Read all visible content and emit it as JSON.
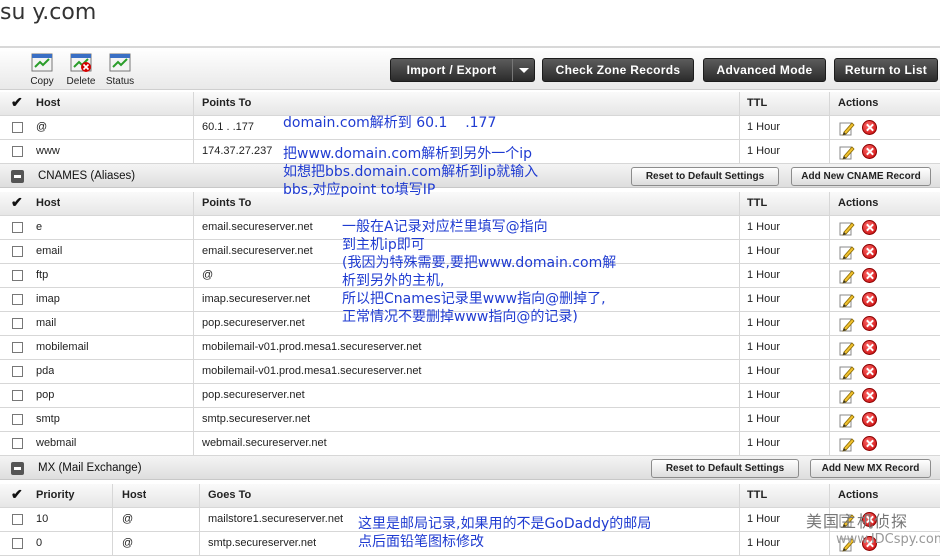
{
  "site": {
    "title": "su   y.com"
  },
  "toolbar": {
    "copy_label": "Copy",
    "delete_label": "Delete",
    "status_label": "Status",
    "import_export_label": "Import / Export",
    "check_zone_label": "Check Zone Records",
    "advanced_mode_label": "Advanced Mode",
    "return_label": "Return to List"
  },
  "a_records": {
    "headers": {
      "host": "Host",
      "points_to": "Points To",
      "ttl": "TTL",
      "actions": "Actions"
    },
    "rows": [
      {
        "host": "@",
        "points_to": "60.1  .  .177",
        "ttl": "1 Hour"
      },
      {
        "host": "www",
        "points_to": "174.37.27.237",
        "ttl": "1 Hour"
      }
    ]
  },
  "cnames": {
    "title": "CNAMES (Aliases)",
    "reset_label": "Reset to Default Settings",
    "add_label": "Add New CNAME Record",
    "headers": {
      "host": "Host",
      "points_to": "Points To",
      "ttl": "TTL",
      "actions": "Actions"
    },
    "rows": [
      {
        "host": "e",
        "points_to": "email.secureserver.net",
        "ttl": "1 Hour"
      },
      {
        "host": "email",
        "points_to": "email.secureserver.net",
        "ttl": "1 Hour"
      },
      {
        "host": "ftp",
        "points_to": "@",
        "ttl": "1 Hour"
      },
      {
        "host": "imap",
        "points_to": "imap.secureserver.net",
        "ttl": "1 Hour"
      },
      {
        "host": "mail",
        "points_to": "pop.secureserver.net",
        "ttl": "1 Hour"
      },
      {
        "host": "mobilemail",
        "points_to": "mobilemail-v01.prod.mesa1.secureserver.net",
        "ttl": "1 Hour"
      },
      {
        "host": "pda",
        "points_to": "mobilemail-v01.prod.mesa1.secureserver.net",
        "ttl": "1 Hour"
      },
      {
        "host": "pop",
        "points_to": "pop.secureserver.net",
        "ttl": "1 Hour"
      },
      {
        "host": "smtp",
        "points_to": "smtp.secureserver.net",
        "ttl": "1 Hour"
      },
      {
        "host": "webmail",
        "points_to": "webmail.secureserver.net",
        "ttl": "1 Hour"
      }
    ]
  },
  "mx": {
    "title": "MX (Mail Exchange)",
    "reset_label": "Reset to Default Settings",
    "add_label": "Add New MX Record",
    "headers": {
      "priority": "Priority",
      "host": "Host",
      "goes_to": "Goes To",
      "ttl": "TTL",
      "actions": "Actions"
    },
    "rows": [
      {
        "priority": "10",
        "host": "@",
        "goes_to": "mailstore1.secureserver.net",
        "ttl": "1 Hour"
      },
      {
        "priority": "0",
        "host": "@",
        "goes_to": "smtp.secureserver.net",
        "ttl": "1 Hour"
      }
    ]
  },
  "annotations": {
    "note1": "domain.com解析到 60.1    .177",
    "note2": "把www.domain.com解析到另外一个ip\n如想把bbs.domain.com解析到ip就输入\nbbs,对应point to填写IP",
    "note3": "一般在A记录对应栏里填写@指向\n到主机ip即可\n(我因为特殊需要,要把www.domain.com解\n析到另外的主机,\n所以把Cnames记录里www指向@删掉了,\n正常情况不要删掉www指向@的记录)",
    "note4": "这里是邮局记录,如果用的不是GoDaddy的邮局\n点后面铅笔图标修改"
  },
  "watermark": {
    "line1": "美国主机侦探",
    "line2": "www.IDCspy.com"
  },
  "colors": {
    "annotation": "#1f3bd1",
    "dark_button": "#333333",
    "delete": "#d40000"
  }
}
